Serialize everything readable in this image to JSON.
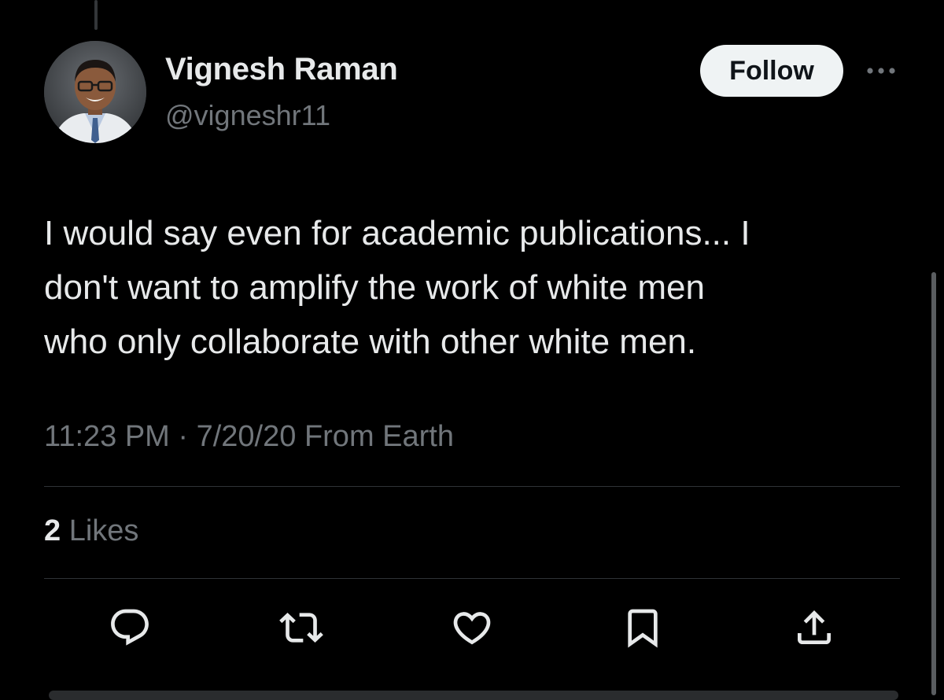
{
  "author": {
    "display_name": "Vignesh Raman",
    "handle": "@vigneshr11"
  },
  "header": {
    "follow_label": "Follow",
    "more_icon": "more-horizontal-icon"
  },
  "tweet": {
    "lines": [
      "I would say even for academic publications... I",
      "don't want to amplify the work of white men",
      "who only collaborate with other white men."
    ],
    "timestamp": "11:23 PM · 7/20/20 From Earth"
  },
  "stats": {
    "likes_count": "2",
    "likes_label": "Likes"
  },
  "actions": [
    {
      "name": "reply",
      "icon": "reply-icon"
    },
    {
      "name": "retweet",
      "icon": "retweet-icon"
    },
    {
      "name": "like",
      "icon": "heart-icon"
    },
    {
      "name": "bookmark",
      "icon": "bookmark-icon"
    },
    {
      "name": "share",
      "icon": "share-icon"
    }
  ],
  "colors": {
    "background": "#000000",
    "primary_text": "#e7e9ea",
    "secondary_text": "#71767b",
    "divider": "#2f3336",
    "follow_button_bg": "#eff3f4",
    "follow_button_text": "#0f1419"
  }
}
